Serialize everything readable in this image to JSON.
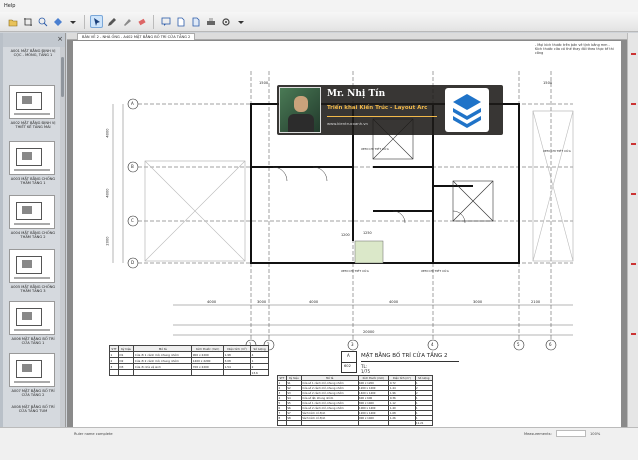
{
  "menu": {
    "help_label": "Help"
  },
  "toolbar": {
    "buttons": [
      "open-icon",
      "crop-icon",
      "zoom-fit-icon",
      "view-icon",
      "select-icon",
      "pen-icon",
      "highlight-icon",
      "eraser-icon",
      "comment-icon",
      "page-icon",
      "export-icon",
      "print-icon",
      "settings-icon"
    ]
  },
  "sidebar": {
    "thumbnails": [
      {
        "label": "A001 MẶT BẰNG ĐỊNH VỊ CỌC - MÓNG, TẦNG 1"
      },
      {
        "label": "A002 MẶT BẰNG ĐỊNH VỊ THIẾT KẾ TẦNG MÁI"
      },
      {
        "label": "A003 MẶT BẰNG CHỐNG THẤM TẦNG 1"
      },
      {
        "label": "A004 MẶT BẰNG CHỐNG THẤM TẦNG 2"
      },
      {
        "label": "A005 MẶT BẰNG CHỐNG THẤM TẦNG 3"
      },
      {
        "label": "A006 MẶT BẰNG BỐ TRÍ CỬA TẦNG 1"
      },
      {
        "label": "A007 MẶT BẰNG BỐ TRÍ CỬA TẦNG 2"
      },
      {
        "label": "A008 MẶT BẰNG BỐ TRÍ CỬA TẦNG TUM"
      }
    ]
  },
  "viewer": {
    "tab_label": "BẢN VẼ 2 - NHÀ ỐNG - A402 MẶT BẰNG BỐ TRÍ CỬA TẦNG 2",
    "note": "- Mọi kích thước trên bản vẽ tính bằng mm - Kích thước cửa có thể thay đổi theo thực tế thi công"
  },
  "banner": {
    "name": "Mr. Nhị Tín",
    "role": "Triển khai Kiến Trúc - Layout Arc",
    "site": "www.kientrucxanh.vn"
  },
  "drawing": {
    "title": "MẶT BẰNG BỐ TRÍ CỬA TẦNG 2",
    "scale": "TL: 1/75",
    "sheet_id": "A",
    "sheet_no": "602",
    "total_dim": "20000",
    "bottom_dims": [
      "4000",
      "3000",
      "4000",
      "4000",
      "3000",
      "2100"
    ],
    "top_dims": [
      "1500",
      "1500"
    ],
    "left_dims": [
      "4000",
      "4000",
      "2000"
    ],
    "row_axes": [
      "A",
      "B",
      "C",
      "D"
    ],
    "col_axes": [
      "1",
      "2",
      "3",
      "4",
      "5",
      "6"
    ],
    "room_labels": [
      "BCH",
      "BCH",
      "1250",
      "1200",
      "3000",
      "3000"
    ],
    "leader_notes": [
      "XEM CHI TIẾT CỬA",
      "XEM CHI TIẾT CỬA",
      "XEM CHI TIẾT CỬA",
      "XEM CHI TIẾT CỬA"
    ]
  },
  "table_left": {
    "headers": [
      "STT",
      "Ký hiệu",
      "Mô tả",
      "Kích thước (mm)",
      "Diện tích (m²)",
      "Số lượng"
    ],
    "rows": [
      [
        "1",
        "D1",
        "Cửa đi 1 cánh mở, khung nhôm",
        "900 x 2200",
        "1.98",
        "4"
      ],
      [
        "2",
        "D2",
        "Cửa đi 2 cánh mở, khung nhôm",
        "1400 x 2200",
        "3.08",
        "1"
      ],
      [
        "3",
        "D3",
        "Cửa đi nhà vệ sinh",
        "700 x 2200",
        "1.54",
        "2"
      ],
      [
        "",
        "",
        "",
        "",
        "",
        "13.6"
      ]
    ]
  },
  "table_right": {
    "headers": [
      "STT",
      "Ký hiệu",
      "Mô tả",
      "Kích thước (mm)",
      "Diện tích (m²)",
      "Số lượng"
    ],
    "rows": [
      [
        "1",
        "S1",
        "Cửa sổ 1 cánh mở, khung nhôm",
        "600 x 1200",
        "0.72",
        "1"
      ],
      [
        "2",
        "S2",
        "Cửa sổ 2 cánh mở, khung nhôm",
        "1200 x 1200",
        "1.44",
        "2"
      ],
      [
        "3",
        "S3",
        "Cửa sổ 2 cánh mở, khung nhôm",
        "1400 x 1400",
        "1.96",
        "2"
      ],
      [
        "4",
        "S4",
        "Cửa sổ lật, khung nhôm",
        "600 x 600",
        "0.36",
        "1"
      ],
      [
        "5",
        "S5",
        "Cửa sổ 1 cánh mở, khung nhôm",
        "800 x 1400",
        "1.12",
        "1"
      ],
      [
        "6",
        "S6",
        "Cửa sổ 2 cánh mở, khung nhôm",
        "1000 x 1400",
        "1.40",
        "1"
      ],
      [
        "7",
        "S7",
        "Vách kính cố định",
        "1200 x 1400",
        "1.68",
        "1"
      ],
      [
        "8",
        "S8",
        "Vách kính cố định",
        "900 x 1400",
        "1.26",
        "1"
      ],
      [
        "",
        "",
        "",
        "",
        "",
        "11.21"
      ]
    ]
  },
  "status": {
    "left": "Ruler name complete",
    "measurements_label": "Measurements:",
    "zoom": "100%"
  }
}
